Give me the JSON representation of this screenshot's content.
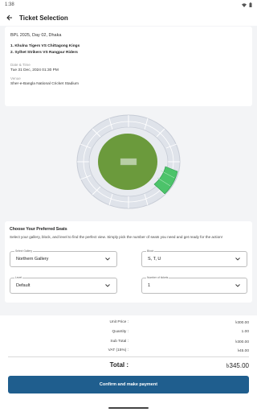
{
  "status_bar": {
    "time": "1:38"
  },
  "header": {
    "title": "Ticket Selection"
  },
  "event": {
    "title": "BPL 2025, Day 02, Dhaka",
    "matches": [
      "1. Khulna Tigers VS Chittagong Kings",
      "2. Sylhet Strikers VS Rangpur Riders"
    ],
    "datetime_label": "Date & Time",
    "datetime": "Tue 31 Dec, 2024 01:30 PM",
    "venue_label": "Venue",
    "venue": "Sher-e-Bangla National Cricket Stadium"
  },
  "seats": {
    "title": "Choose Your Preferred Seats",
    "description": "Select your gallery, block, and level to find the perfect view. Simply pick the number of seats you need and get ready for the action!",
    "gallery": {
      "label": "Select Gallery",
      "value": "Northern Gallery"
    },
    "block": {
      "label": "Block",
      "value": "S, T, U"
    },
    "level": {
      "label": "Level",
      "value": "Default"
    },
    "tickets": {
      "label": "Number of tickets",
      "value": "1"
    }
  },
  "summary": {
    "unit_price_label": "Unit Price :",
    "unit_price": "৳300.00",
    "quantity_label": "Quantity :",
    "quantity": "1.00",
    "subtotal_label": "Sub Total :",
    "subtotal": "৳300.00",
    "vat_label": "VAT (15%) :",
    "vat": "৳45.00",
    "total_label": "Total :",
    "total": "৳345.00"
  },
  "pay_button": {
    "label": "Confirm and make payment"
  },
  "colors": {
    "accent": "#1f5e8e",
    "pitch": "#6b9a3c",
    "selected_block": "#4cc36a"
  }
}
